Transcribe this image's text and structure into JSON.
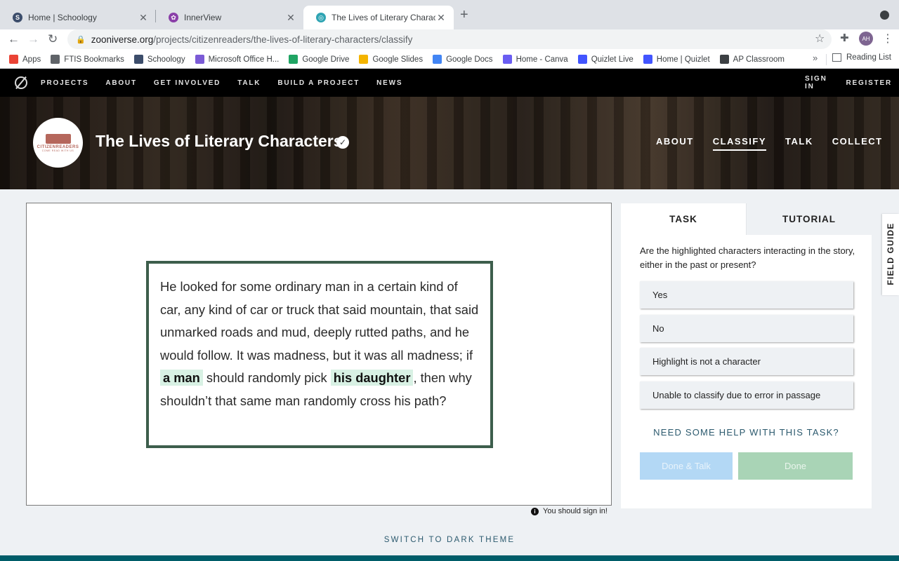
{
  "browser": {
    "tabs": [
      {
        "title": "Home | Schoology",
        "icon_color": "#3c4d6b"
      },
      {
        "title": "InnerView",
        "icon_color": "#8a3fa8"
      },
      {
        "title": "The Lives of Literary Characters",
        "icon_color": "#2fa4b3"
      }
    ],
    "url_host": "zooniverse.org",
    "url_path": "/projects/citizenreaders/the-lives-of-literary-characters/classify",
    "profile_initials": "AH",
    "bookmarks": [
      {
        "label": "Apps",
        "icon_color": "#ea4335"
      },
      {
        "label": "FTIS Bookmarks",
        "icon_color": "#5f6368"
      },
      {
        "label": "Schoology",
        "icon_color": "#3c4d6b"
      },
      {
        "label": "Microsoft Office H...",
        "icon_color": "#7b5bd6"
      },
      {
        "label": "Google Drive",
        "icon_color": "#1fa463"
      },
      {
        "label": "Google Slides",
        "icon_color": "#f4b400"
      },
      {
        "label": "Google Docs",
        "icon_color": "#4285f4"
      },
      {
        "label": "Home - Canva",
        "icon_color": "#6a5df2"
      },
      {
        "label": "Quizlet Live",
        "icon_color": "#4255ff"
      },
      {
        "label": "Home | Quizlet",
        "icon_color": "#4255ff"
      },
      {
        "label": "AP Classroom",
        "icon_color": "#3c4043"
      }
    ],
    "bookmarks_more": "»",
    "reading_list": "Reading List"
  },
  "zooniverse_nav": {
    "items": [
      "PROJECTS",
      "ABOUT",
      "GET INVOLVED",
      "TALK",
      "BUILD A PROJECT",
      "NEWS"
    ],
    "sign_in": "SIGN IN",
    "register": "REGISTER"
  },
  "project": {
    "title": "The Lives of Literary Characters",
    "avatar_brand": "CITIZENREADERS",
    "avatar_sub": "COME READ WITH US",
    "tabs": [
      "ABOUT",
      "CLASSIFY",
      "TALK",
      "COLLECT"
    ],
    "active_tab": "CLASSIFY"
  },
  "subject": {
    "text_1": "He looked for some ordinary man in a certain kind of car, any kind of car or truck that said mountain, that said unmarked roads and mud, deeply rutted paths, and he would follow. It was madness, but it was all madness; if ",
    "highlight_1": "a man",
    "text_2": " should randomly pick ",
    "highlight_2": "his daughter",
    "text_3": ", then why shouldn’t that same man randomly cross his path?",
    "sign_in_notice": "You should sign in!"
  },
  "task": {
    "tabs": [
      "TASK",
      "TUTORIAL"
    ],
    "question": "Are the highlighted characters interacting in the story, either in the past or present?",
    "answers": [
      "Yes",
      "No",
      "Highlight is not a character",
      "Unable to classify due to error in passage"
    ],
    "help_link": "NEED SOME HELP WITH THIS TASK?",
    "done_talk": "Done & Talk",
    "done": "Done"
  },
  "field_guide": "FIELD GUIDE",
  "theme_toggle": "SWITCH TO DARK THEME"
}
